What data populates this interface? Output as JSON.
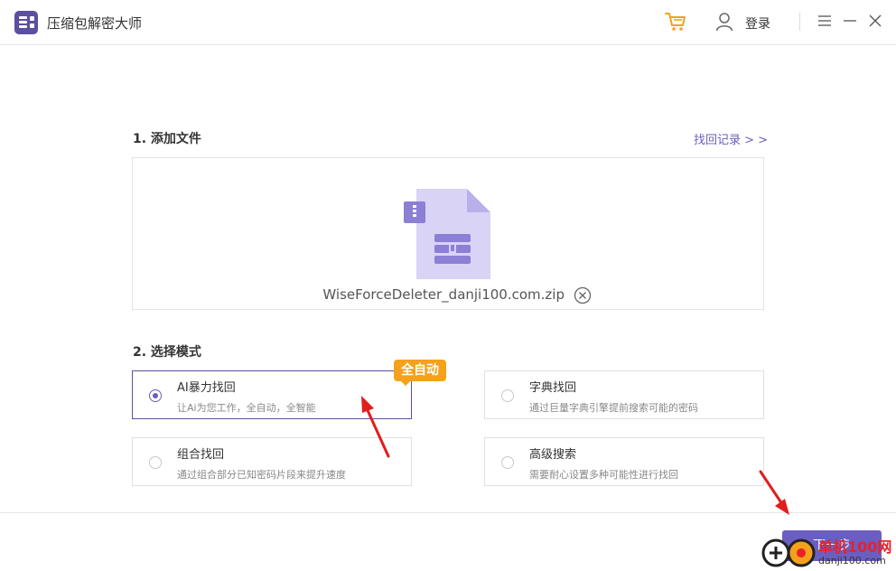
{
  "app": {
    "title": "压缩包解密大师"
  },
  "header": {
    "login_label": "登录"
  },
  "section1": {
    "title": "1. 添加文件",
    "history_link": "找回记录 > >",
    "file_name": "WiseForceDeleter_danji100.com.zip"
  },
  "section2": {
    "title": "2. 选择模式",
    "badge": "全自动",
    "modes": [
      {
        "title": "AI暴力找回",
        "desc": "让Ai为您工作，全自动，全智能",
        "selected": true
      },
      {
        "title": "字典找回",
        "desc": "通过巨量字典引擎提前搜索可能的密码",
        "selected": false
      },
      {
        "title": "组合找回",
        "desc": "通过组合部分已知密码片段来提升速度",
        "selected": false
      },
      {
        "title": "高级搜索",
        "desc": "需要耐心设置多种可能性进行找回",
        "selected": false
      }
    ]
  },
  "footer": {
    "next_label": "下一步"
  },
  "watermark": {
    "line1": "单机100网",
    "line2": "danji100.com"
  },
  "colors": {
    "accent": "#6a5fc0",
    "badge": "#f5a11c",
    "cart": "#f5a11c",
    "file_icon": "#d9d3f5",
    "arrow": "#e11d1d"
  },
  "icons": [
    "app-logo-icon",
    "cart-icon",
    "user-icon",
    "menu-icon",
    "minimize-icon",
    "close-icon",
    "zip-file-icon",
    "remove-file-icon"
  ]
}
